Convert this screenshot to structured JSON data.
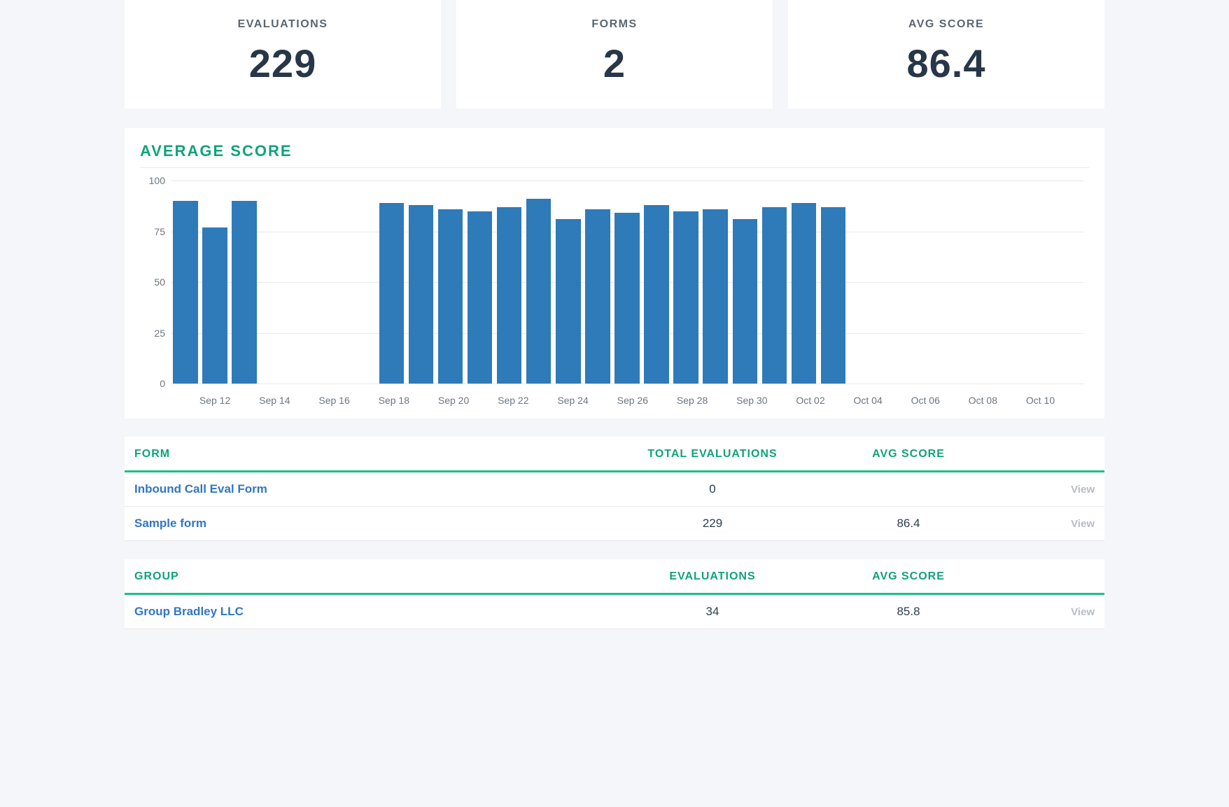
{
  "stats": {
    "evaluations": {
      "label": "EVALUATIONS",
      "value": "229"
    },
    "forms": {
      "label": "FORMS",
      "value": "2"
    },
    "avg_score": {
      "label": "AVG SCORE",
      "value": "86.4"
    }
  },
  "chart_title": "AVERAGE  SCORE",
  "chart_data": {
    "type": "bar",
    "title": "AVERAGE SCORE",
    "xlabel": "",
    "ylabel": "",
    "ylim": [
      0,
      100
    ],
    "yticks": [
      0,
      25,
      50,
      75,
      100
    ],
    "categories": [
      "Sep 11",
      "Sep 12",
      "Sep 13",
      "Sep 14",
      "Sep 15",
      "Sep 16",
      "Sep 17",
      "Sep 18",
      "Sep 19",
      "Sep 20",
      "Sep 21",
      "Sep 22",
      "Sep 23",
      "Sep 24",
      "Sep 25",
      "Sep 26",
      "Sep 27",
      "Sep 28",
      "Sep 29",
      "Sep 30",
      "Oct 01",
      "Oct 02",
      "Oct 03",
      "Oct 04",
      "Oct 05",
      "Oct 06",
      "Oct 07",
      "Oct 08",
      "Oct 09",
      "Oct 10",
      "Oct 11"
    ],
    "values": [
      90,
      77,
      90,
      null,
      null,
      null,
      null,
      89,
      88,
      86,
      85,
      87,
      91,
      81,
      86,
      84,
      88,
      85,
      86,
      81,
      87,
      89,
      87,
      null,
      null,
      null,
      null,
      null,
      null,
      null,
      null
    ],
    "xtick_every": 2,
    "xtick_start_index": 1
  },
  "forms_table": {
    "headers": {
      "form": "FORM",
      "total": "TOTAL EVALUATIONS",
      "avg": "AVG SCORE"
    },
    "view_label": "View",
    "rows": [
      {
        "name": "Inbound Call Eval Form",
        "total": "0",
        "avg": ""
      },
      {
        "name": "Sample form",
        "total": "229",
        "avg": "86.4"
      }
    ]
  },
  "groups_table": {
    "headers": {
      "group": "GROUP",
      "evals": "EVALUATIONS",
      "avg": "AVG SCORE"
    },
    "view_label": "View",
    "rows": [
      {
        "name": "Group Bradley LLC",
        "evals": "34",
        "avg": "85.8"
      }
    ]
  }
}
